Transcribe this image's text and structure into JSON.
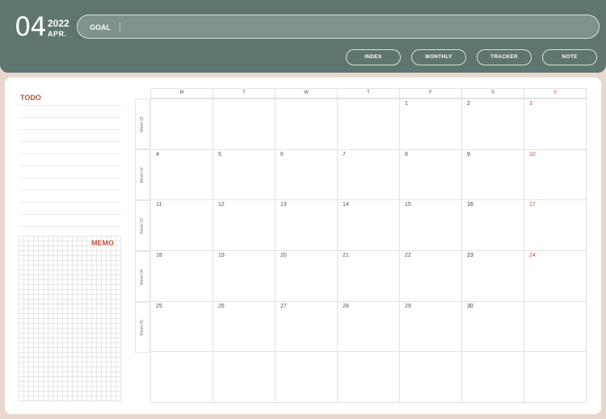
{
  "header": {
    "month_number": "04",
    "year": "2022",
    "month_abbr": "APR.",
    "goal_label": "GOAL",
    "nav": [
      "INDEX",
      "MONTHLY",
      "TRACKER",
      "NOTE"
    ]
  },
  "sidebar": {
    "todo_title": "TODO",
    "memo_title": "MEMO"
  },
  "calendar": {
    "weekdays": [
      "M",
      "T",
      "W",
      "T",
      "F",
      "S",
      "S"
    ],
    "weeks": [
      "Week 01",
      "Week 02",
      "Week 03",
      "Week 04",
      "Week 05"
    ],
    "days": [
      [
        "",
        "",
        "",
        "",
        "1",
        "2",
        "3"
      ],
      [
        "4",
        "5",
        "6",
        "7",
        "8",
        "9",
        "10"
      ],
      [
        "11",
        "12",
        "13",
        "14",
        "15",
        "16",
        "17"
      ],
      [
        "18",
        "19",
        "20",
        "21",
        "22",
        "23",
        "24"
      ],
      [
        "25",
        "26",
        "27",
        "28",
        "29",
        "30",
        ""
      ],
      [
        "",
        "",
        "",
        "",
        "",
        "",
        ""
      ]
    ]
  },
  "colors": {
    "header_bg": "#5f7670",
    "accent_red": "#c0513c",
    "page_bg": "#e7d8cf"
  }
}
